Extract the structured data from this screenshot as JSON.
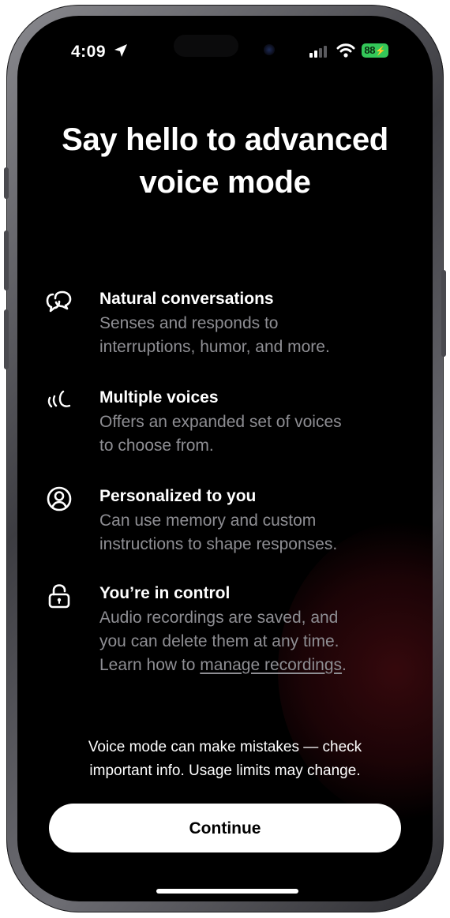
{
  "status_bar": {
    "time": "4:09",
    "battery": "88"
  },
  "title": "Say hello to advanced voice mode",
  "features": [
    {
      "icon": "chat-bubbles-icon",
      "title": "Natural conversations",
      "desc_lines": [
        "Senses and responds to",
        "interruptions, humor, and more."
      ]
    },
    {
      "icon": "voice-waves-icon",
      "title": "Multiple voices",
      "desc_lines": [
        "Offers an expanded set of voices",
        "to choose from."
      ]
    },
    {
      "icon": "person-circle-icon",
      "title": "Personalized to you",
      "desc_lines": [
        "Can use memory and custom",
        "instructions to shape responses."
      ]
    },
    {
      "icon": "lock-icon",
      "title": "You’re in control",
      "desc_lines": [
        "Audio recordings are saved, and",
        "you can delete them at any time."
      ],
      "link_prefix": "Learn how to ",
      "link_text": "manage recordings",
      "link_suffix": "."
    }
  ],
  "disclaimer": {
    "line1": "Voice mode can make mistakes — check",
    "line2": "important info. Usage limits may change."
  },
  "continue_label": "Continue",
  "colors": {
    "background": "#000000",
    "primary_text": "#ffffff",
    "secondary_text": "#8e8e93",
    "button_bg": "#ffffff",
    "battery_green": "#34c759"
  }
}
